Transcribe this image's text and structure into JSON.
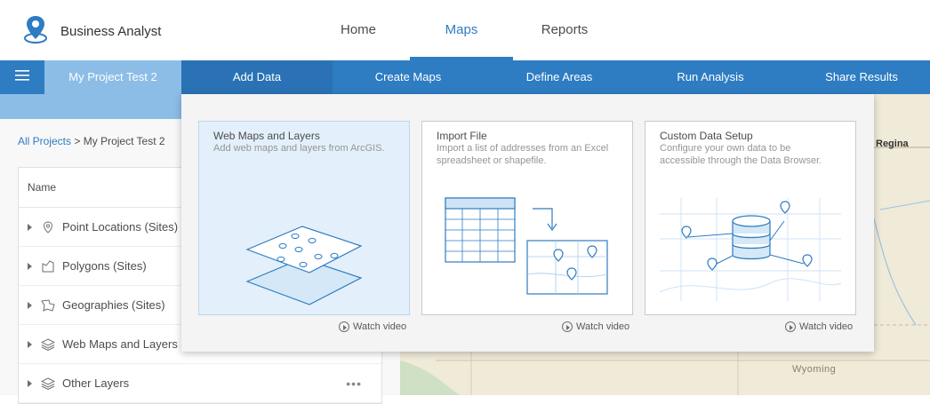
{
  "app": {
    "name": "Business Analyst",
    "logo_icon": "location-pin-icon"
  },
  "topnav": [
    {
      "label": "Home",
      "active": false
    },
    {
      "label": "Maps",
      "active": true
    },
    {
      "label": "Reports",
      "active": false
    }
  ],
  "toolbar": {
    "menu_icon": "hamburger-menu-icon",
    "project_name": "My Project Test 2",
    "steps": [
      {
        "label": "Add Data",
        "active": true
      },
      {
        "label": "Create Maps",
        "active": false
      },
      {
        "label": "Define Areas",
        "active": false
      },
      {
        "label": "Run Analysis",
        "active": false
      },
      {
        "label": "Share Results",
        "active": false
      }
    ]
  },
  "breadcrumb": {
    "root": "All Projects",
    "separator": ">",
    "current": "My Project Test 2"
  },
  "layers_table": {
    "header": "Name",
    "rows": [
      {
        "label": "Point Locations (Sites)",
        "icon": "pin-icon"
      },
      {
        "label": "Polygons (Sites)",
        "icon": "polygon-icon"
      },
      {
        "label": "Geographies (Sites)",
        "icon": "geography-icon"
      },
      {
        "label": "Web Maps and Layers",
        "icon": "layers-icon"
      },
      {
        "label": "Other Layers",
        "icon": "layers-icon",
        "more": "•••"
      }
    ]
  },
  "map": {
    "labels": {
      "regina": "Regina",
      "wyoming": "Wyoming"
    }
  },
  "add_data_popup": {
    "cards": [
      {
        "title": "Web Maps and Layers",
        "description": "Add web maps and layers from ArcGIS.",
        "selected": true,
        "watch": "Watch video"
      },
      {
        "title": "Import File",
        "description": "Import a list of addresses from an Excel spreadsheet or shapefile.",
        "selected": false,
        "watch": "Watch video"
      },
      {
        "title": "Custom Data Setup",
        "description": "Configure your own data to be accessible through the Data Browser.",
        "selected": false,
        "watch": "Watch video"
      }
    ]
  },
  "colors": {
    "accent": "#2e7cc2",
    "accent_light": "#8cbde6",
    "selected_card": "#e3f0fb"
  }
}
